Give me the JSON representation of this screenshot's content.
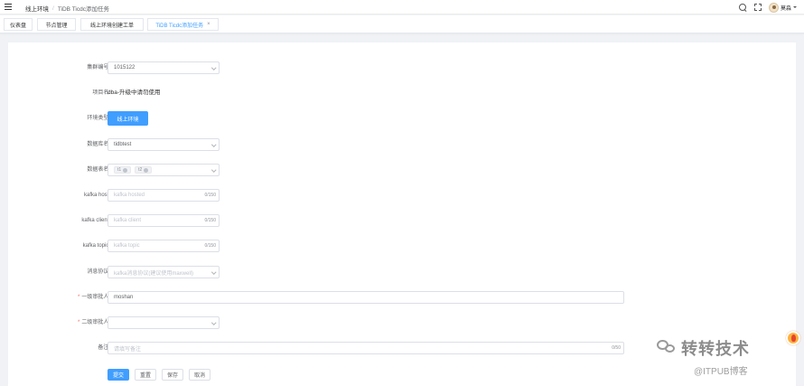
{
  "header": {
    "breadcrumb": [
      "线上环境",
      "TiDB Ticdc添加任务"
    ],
    "breadcrumb_separator": "/",
    "username": "莫淼"
  },
  "tabs": [
    {
      "label": "仪表盘"
    },
    {
      "label": "节点管理"
    },
    {
      "label": "线上环境创建工单"
    },
    {
      "label": "TiDB Ticdc添加任务",
      "active": true,
      "close": "×"
    }
  ],
  "form": {
    "cluster_no": {
      "label": "集群编号:",
      "value": "1015122"
    },
    "project_name": {
      "label": "项目名:",
      "value": "dba-升级中请勿使用"
    },
    "env_type": {
      "label": "环境类型:",
      "value": "线上环境"
    },
    "db_name": {
      "label": "数据库名:",
      "value": "tidbtest"
    },
    "table_name": {
      "label": "数据表名:",
      "tags": [
        "t1",
        "t2"
      ]
    },
    "kafka_host": {
      "label": "kafka host:",
      "placeholder": "kafka hosted",
      "counter": "0/150"
    },
    "kafka_client": {
      "label": "kafka client:",
      "placeholder": "kafka client",
      "counter": "0/150"
    },
    "kafka_topic": {
      "label": "kafka topic:",
      "placeholder": "kafka topic",
      "counter": "0/150"
    },
    "protocol": {
      "label": "消息协议:",
      "placeholder": "kafka消息协议(建议使用maxwell)"
    },
    "approver1": {
      "label": "一级审批人:",
      "required_mark": "*",
      "value": "moshan"
    },
    "approver2": {
      "label": "二级审批人:",
      "required_mark": "*",
      "value": ""
    },
    "remark": {
      "label": "备注:",
      "placeholder": "请填写备注",
      "counter": "0/50"
    }
  },
  "buttons": {
    "submit": "提交",
    "reset": "重置",
    "save": "保存",
    "cancel": "取消"
  },
  "watermark": {
    "title": "转转技术",
    "subtitle": "@ITPUB博客"
  },
  "colors": {
    "primary": "#409eff",
    "required": "#f56c6c",
    "page_bg": "#f0f2f5"
  }
}
